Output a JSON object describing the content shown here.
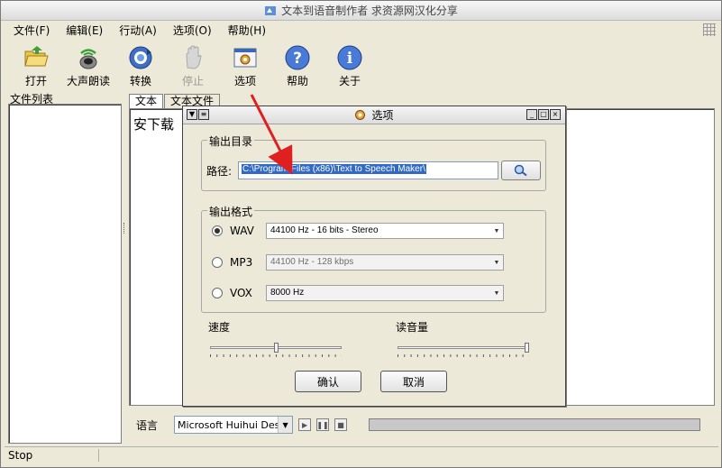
{
  "window": {
    "title": "文本到语音制作者 求资源网汉化分享"
  },
  "menu": {
    "items": [
      "文件(F)",
      "编辑(E)",
      "行动(A)",
      "选项(O)",
      "帮助(H)"
    ]
  },
  "toolbar": {
    "open": "打开",
    "read_aloud": "大声朗读",
    "convert": "转换",
    "stop": "停止",
    "options": "选项",
    "help": "帮助",
    "about": "关于"
  },
  "left_panel": {
    "title": "文件列表"
  },
  "tabs": [
    "文本",
    "文本文件"
  ],
  "editor": {
    "text": "安下载"
  },
  "bottom": {
    "language_label": "语言",
    "language_value": "Microsoft Huihui Deskto"
  },
  "status": {
    "text": "Stop"
  },
  "dialog": {
    "title": "选项",
    "output_dir": {
      "group_title": "输出目录",
      "path_label": "路径:",
      "path_value": "C:\\Program Files (x86)\\Text to Speech Maker\\"
    },
    "output_format": {
      "group_title": "输出格式",
      "formats": [
        {
          "name": "WAV",
          "value": "44100 Hz - 16 bits - Stereo",
          "selected": true
        },
        {
          "name": "MP3",
          "value": "44100 Hz - 128 kbps",
          "selected": false
        },
        {
          "name": "VOX",
          "value": "8000 Hz",
          "selected": false
        }
      ]
    },
    "speed": {
      "label": "速度",
      "level": 0.5
    },
    "volume": {
      "label": "读音量",
      "level": 1.0
    },
    "ok_label": "确认",
    "cancel_label": "取消"
  },
  "colors": {
    "selection": "#316ac5",
    "annotation_arrow": "#e02020"
  }
}
